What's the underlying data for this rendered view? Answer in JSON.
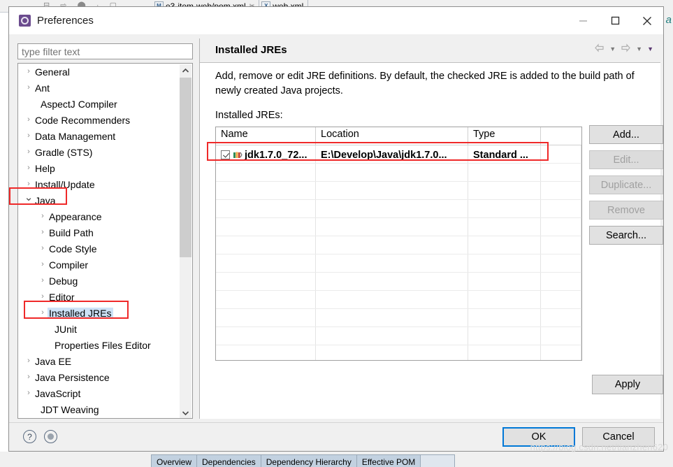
{
  "background": {
    "toolbar_icons": "⊟ ⇨ ⬤ · ▢",
    "tabs": [
      {
        "icon": "M",
        "label": "e3-item-web/pom.xml",
        "close": "✂"
      },
      {
        "icon": "X",
        "label": "web.xml",
        "close": ""
      }
    ],
    "right_text": "/ a",
    "bottom_tabs": [
      "Overview",
      "Dependencies",
      "Dependency Hierarchy",
      "Effective POM",
      ""
    ]
  },
  "dialog": {
    "title": "Preferences",
    "title_icon": "gear-icon",
    "window_controls": {
      "minimize": "minimize-icon",
      "maximize": "maximize-icon",
      "close": "close-icon"
    }
  },
  "sidebar": {
    "filter": {
      "value": "",
      "placeholder": "type filter text"
    },
    "items": [
      {
        "label": "General",
        "indent": 0,
        "arrow": "collapsed",
        "selected": false
      },
      {
        "label": "Ant",
        "indent": 0,
        "arrow": "collapsed",
        "selected": false
      },
      {
        "label": "AspectJ Compiler",
        "indent": 0,
        "arrow": "none",
        "selected": false
      },
      {
        "label": "Code Recommenders",
        "indent": 0,
        "arrow": "collapsed",
        "selected": false
      },
      {
        "label": "Data Management",
        "indent": 0,
        "arrow": "collapsed",
        "selected": false
      },
      {
        "label": "Gradle (STS)",
        "indent": 0,
        "arrow": "collapsed",
        "selected": false
      },
      {
        "label": "Help",
        "indent": 0,
        "arrow": "collapsed",
        "selected": false
      },
      {
        "label": "Install/Update",
        "indent": 0,
        "arrow": "collapsed",
        "selected": false
      },
      {
        "label": "Java",
        "indent": 0,
        "arrow": "expanded",
        "selected": false
      },
      {
        "label": "Appearance",
        "indent": 1,
        "arrow": "collapsed",
        "selected": false
      },
      {
        "label": "Build Path",
        "indent": 1,
        "arrow": "collapsed",
        "selected": false
      },
      {
        "label": "Code Style",
        "indent": 1,
        "arrow": "collapsed",
        "selected": false
      },
      {
        "label": "Compiler",
        "indent": 1,
        "arrow": "collapsed",
        "selected": false
      },
      {
        "label": "Debug",
        "indent": 1,
        "arrow": "collapsed",
        "selected": false
      },
      {
        "label": "Editor",
        "indent": 1,
        "arrow": "collapsed",
        "selected": false
      },
      {
        "label": "Installed JREs",
        "indent": 1,
        "arrow": "collapsed",
        "selected": true
      },
      {
        "label": "JUnit",
        "indent": 1,
        "arrow": "none",
        "selected": false
      },
      {
        "label": "Properties Files Editor",
        "indent": 1,
        "arrow": "none",
        "selected": false
      },
      {
        "label": "Java EE",
        "indent": 0,
        "arrow": "collapsed",
        "selected": false
      },
      {
        "label": "Java Persistence",
        "indent": 0,
        "arrow": "collapsed",
        "selected": false
      },
      {
        "label": "JavaScript",
        "indent": 0,
        "arrow": "collapsed",
        "selected": false
      },
      {
        "label": "JDT Weaving",
        "indent": 0,
        "arrow": "none",
        "selected": false
      }
    ],
    "scrollbar": {
      "up": "▲",
      "down": "▼"
    }
  },
  "content": {
    "title": "Installed JREs",
    "nav": {
      "back": "⇦",
      "back_caret": "▼",
      "forward": "⇨",
      "forward_caret": "▼",
      "menu_caret": "▼"
    },
    "description": "Add, remove or edit JRE definitions. By default, the checked JRE is added to the build path of newly created Java projects.",
    "table_label": "Installed JREs:",
    "table": {
      "columns": [
        "Name",
        "Location",
        "Type",
        ""
      ],
      "rows": [
        {
          "checked": true,
          "name": "jdk1.7.0_72...",
          "location": "E:\\Develop\\Java\\jdk1.7.0...",
          "type": "Standard ...",
          "pad": ""
        }
      ],
      "empty_row_count": 11
    },
    "side_buttons": [
      {
        "label": "Add...",
        "enabled": true
      },
      {
        "label": "Edit...",
        "enabled": false
      },
      {
        "label": "Duplicate...",
        "enabled": false
      },
      {
        "label": "Remove",
        "enabled": false
      },
      {
        "label": "Search...",
        "enabled": true
      }
    ],
    "apply_label": "Apply"
  },
  "footer": {
    "help_icon": "?",
    "restore_icon": "restore-defaults-icon",
    "ok_label": "OK",
    "cancel_label": "Cancel"
  },
  "watermark": "https://blog.csdn.net/tianzhen620",
  "colors": {
    "accent": "#0078d7",
    "annotation": "#ef2929",
    "selection": "#cde2f7",
    "dialog_bg": "#f0f0f0"
  }
}
